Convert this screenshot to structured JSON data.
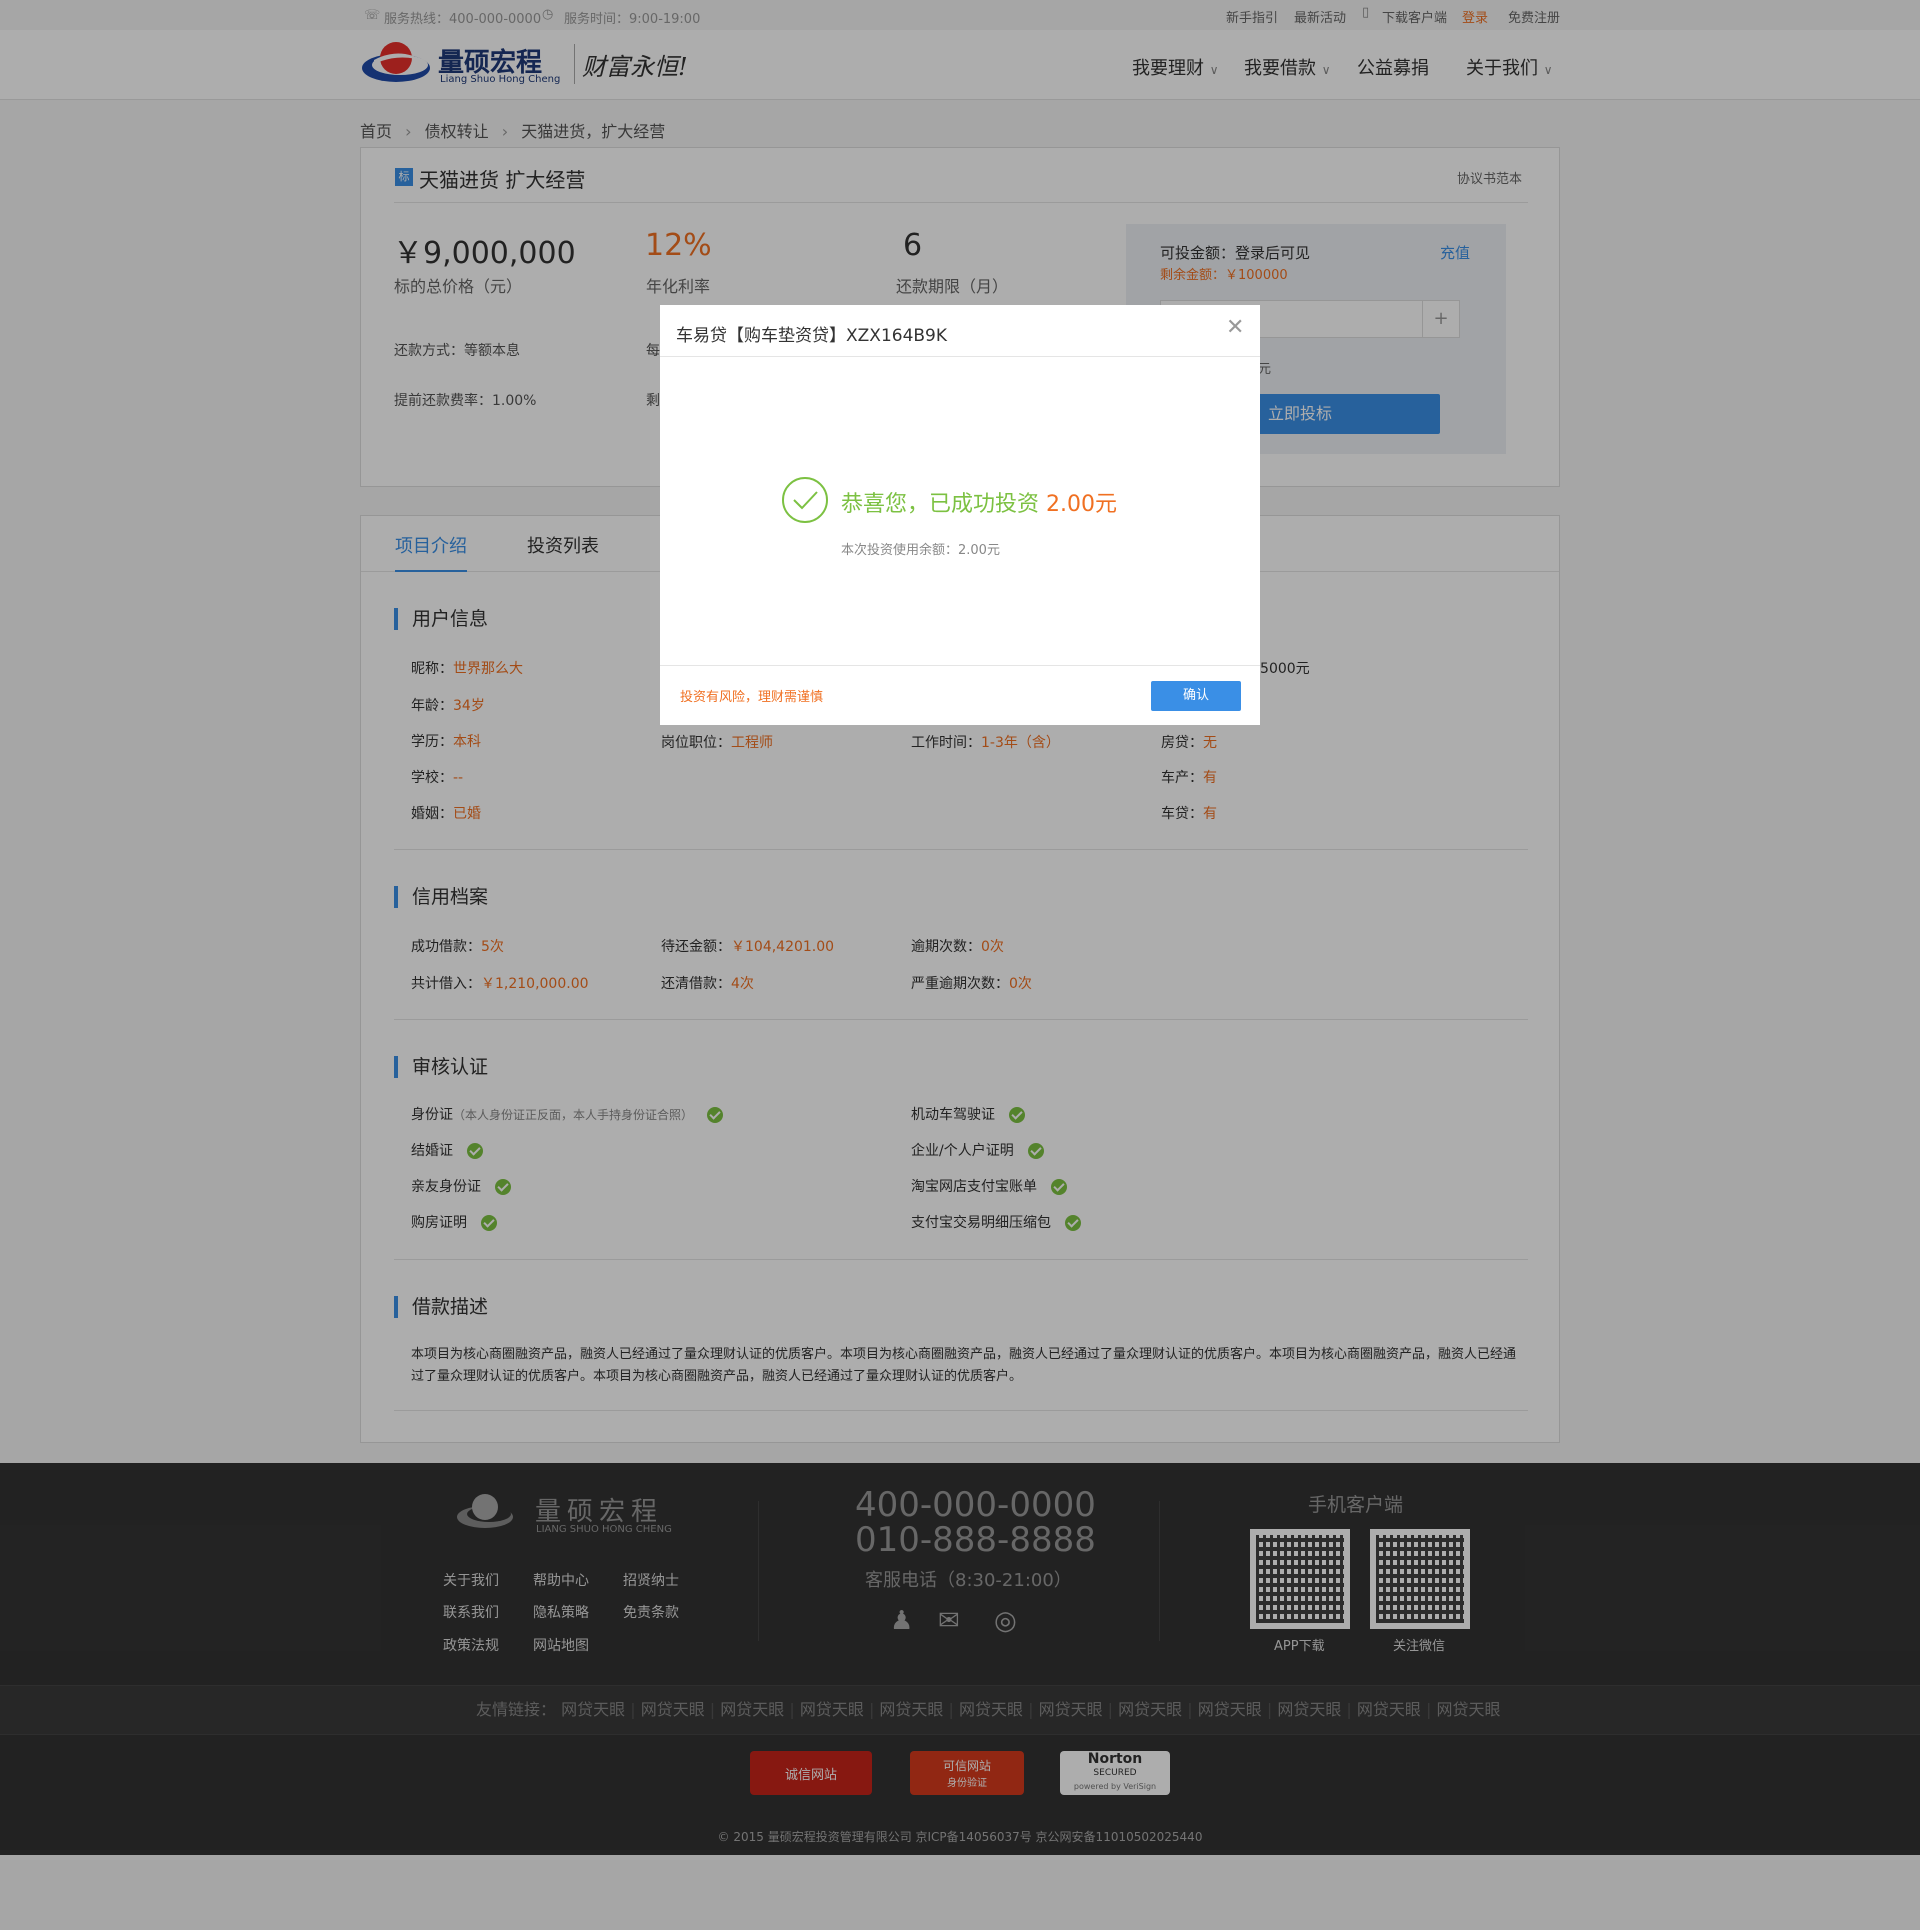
{
  "topbar": {
    "hotline": "服务热线：400-000-0000",
    "hours": "服务时间：9:00-19:00",
    "links": [
      "新手指引",
      "最新活动",
      "下载客户端",
      "登录",
      "免费注册"
    ]
  },
  "header": {
    "logo_cn": "量硕宏程",
    "logo_en": "Liang Shuo  Hong Cheng",
    "slogan": "财富永恒!",
    "nav": [
      "我要理财",
      "我要借款",
      "公益募捐",
      "关于我们"
    ]
  },
  "breadcrumb": [
    "首页",
    "债权转让",
    "天猫进货，扩大经营"
  ],
  "project": {
    "badge": "标",
    "title": "天猫进货  扩大经营",
    "agreement": "协议书范本",
    "stats": [
      {
        "value": "￥9,000,000",
        "label": "标的总价格（元）"
      },
      {
        "value": "12%",
        "label": "年化利率"
      },
      {
        "value": "6",
        "label": "还款期限（月）"
      }
    ],
    "repay_method": "还款方式：等额本息",
    "prepay_fee": "提前还款费率：1.00%",
    "cut_a": "每",
    "cut_b": "剩"
  },
  "invest_panel": {
    "available": "可投金额：登录后可见",
    "recharge": "充值",
    "remaining_label": "剩余金额：",
    "remaining_value": "￥100000",
    "plus": "+",
    "unit_cut": "元",
    "submit": "立即投标"
  },
  "tabs": [
    "项目介绍",
    "投资列表"
  ],
  "user_info": {
    "title": "用户信息",
    "col1": [
      {
        "k": "昵称：",
        "v": "世界那么大"
      },
      {
        "k": "年龄：",
        "v": "34岁"
      },
      {
        "k": "学历：",
        "v": "本科"
      },
      {
        "k": "学校：",
        "v": "--"
      },
      {
        "k": "婚姻：",
        "v": "已婚"
      }
    ],
    "job": {
      "k": "岗位职位：",
      "v": "工程师"
    },
    "work_time": {
      "k": "工作时间：",
      "v": "1-3年（含）"
    },
    "income_cut": "-5000元",
    "col4": [
      {
        "k": "房贷：",
        "v": "无"
      },
      {
        "k": "车产：",
        "v": "有"
      },
      {
        "k": "车贷：",
        "v": "有"
      }
    ]
  },
  "credit": {
    "title": "信用档案",
    "items": [
      {
        "k": "成功借款：",
        "v": "5次"
      },
      {
        "k": "待还金额：",
        "v": "￥104,4201.00"
      },
      {
        "k": "逾期次数：",
        "v": "0次"
      },
      {
        "k": "共计借入：",
        "v": "￥1,210,000.00"
      },
      {
        "k": "还清借款：",
        "v": "4次"
      },
      {
        "k": "严重逾期次数：",
        "v": "0次"
      }
    ]
  },
  "audit": {
    "title": "审核认证",
    "left": [
      {
        "k": "身份证",
        "note": "（本人身份证正反面，本人手持身份证合照）"
      },
      {
        "k": "结婚证",
        "note": ""
      },
      {
        "k": "亲友身份证",
        "note": ""
      },
      {
        "k": "购房证明",
        "note": ""
      }
    ],
    "right": [
      "机动车驾驶证",
      "企业/个人户证明",
      "淘宝网店支付宝账单",
      "支付宝交易明细压缩包"
    ]
  },
  "description": {
    "title": "借款描述",
    "text": "本项目为核心商圈融资产品，融资人已经通过了量众理财认证的优质客户。本项目为核心商圈融资产品，融资人已经通过了量众理财认证的优质客户。本项目为核心商圈融资产品，融资人已经通过了量众理财认证的优质客户。本项目为核心商圈融资产品，融资人已经通过了量众理财认证的优质客户。"
  },
  "footer": {
    "logo_cn": "量硕宏程",
    "logo_en": "LIANG SHUO  HONG CHENG",
    "links": [
      "关于我们",
      "帮助中心",
      "招贤纳士",
      "联系我们",
      "隐私策略",
      "免责条款",
      "政策法规",
      "网站地图"
    ],
    "phone1": "400-000-0000",
    "phone2": "010-888-8888",
    "service": "客服电话（8:30-21:00）",
    "mobile_title": "手机客户端",
    "qr1": "APP下载",
    "qr2": "关注微信",
    "friend_label": "友情链接：",
    "friend_links": [
      "网贷天眼",
      "网贷天眼",
      "网贷天眼",
      "网贷天眼",
      "网贷天眼",
      "网贷天眼",
      "网贷天眼",
      "网贷天眼",
      "网贷天眼",
      "网贷天眼",
      "网贷天眼",
      "网贷天眼"
    ],
    "badges": [
      "诚信网站",
      "可信网站",
      "Norton",
      "SECURED",
      "powered by VeriSign"
    ],
    "badge_sub": "身份验证",
    "copyright": "© 2015 量硕宏程投资管理有限公司 京ICP备14056037号 京公网安备11010502025440"
  },
  "modal": {
    "title": "车易贷【购车垫资贷】XZX164B9K",
    "success_text": "恭喜您，已成功投资",
    "amount": "2.00元",
    "balance_note": "本次投资使用余额：2.00元",
    "risk": "投资有风险，理财需谨慎",
    "confirm": "确认"
  },
  "colors": {
    "accent": "#3a8fe6",
    "orange": "#f07022",
    "green": "#7cc142"
  }
}
